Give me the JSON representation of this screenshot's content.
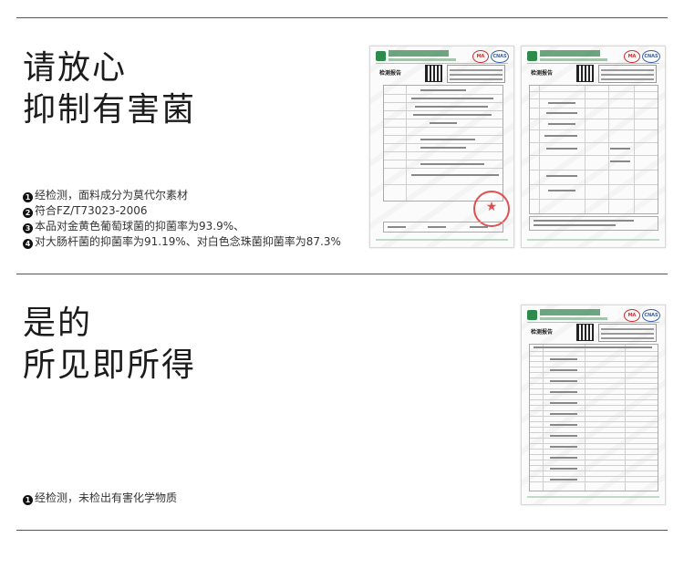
{
  "section1": {
    "heading_lines": [
      "请放心",
      "抑制有害菌"
    ],
    "bullets": [
      {
        "num": "1",
        "text": "经检测，面料成分为莫代尔素材"
      },
      {
        "num": "2",
        "text": "符合FZ/T73023-2006"
      },
      {
        "num": "3",
        "text": "本品对金黄色葡萄球菌的抑菌率为93.9%、"
      },
      {
        "num": "4",
        "text": "对大肠杆菌的抑菌率为91.19%、对白色念珠菌抑菌率为87.3%"
      }
    ]
  },
  "section2": {
    "heading_lines": [
      "是的",
      "所见即所得"
    ],
    "bullets": [
      {
        "num": "1",
        "text": "经检测，未检出有害化学物质"
      }
    ]
  },
  "documents": {
    "doc_title": "检测报告",
    "cert_badges": [
      "MA",
      "CNAS"
    ],
    "stamp_color": "#dd3333",
    "brand_green": "#2e8b4c"
  }
}
